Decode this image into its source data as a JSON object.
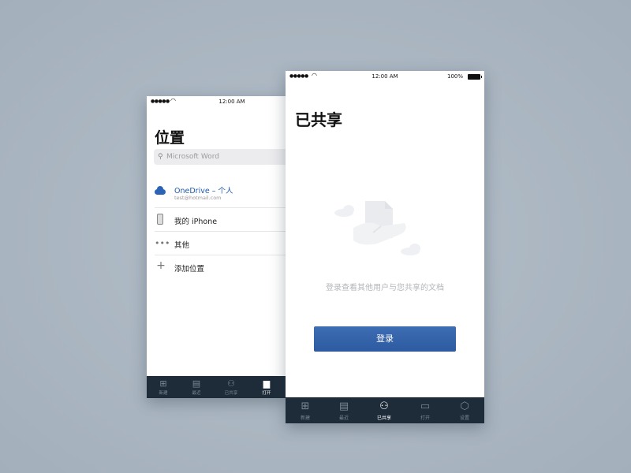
{
  "back_phone": {
    "status": {
      "time": "12:00 AM"
    },
    "title": "位置",
    "search": {
      "placeholder": "Microsoft Word"
    },
    "locations": [
      {
        "label": "OneDrive – 个人",
        "sub": "test@hotmail.com",
        "icon": "onedrive-cloud-icon"
      },
      {
        "label": "我的 iPhone",
        "icon": "iphone-icon"
      },
      {
        "label": "其他",
        "icon": "more-dots-icon"
      },
      {
        "label": "添加位置",
        "icon": "plus-icon"
      }
    ],
    "tabs": [
      {
        "label": "新建",
        "icon": "new-doc-icon",
        "active": false
      },
      {
        "label": "最近",
        "icon": "recent-icon",
        "active": false
      },
      {
        "label": "已共享",
        "icon": "shared-people-icon",
        "active": false
      },
      {
        "label": "打开",
        "icon": "folder-icon",
        "active": true
      }
    ]
  },
  "front_phone": {
    "status": {
      "time": "12:00 AM",
      "battery": "100%"
    },
    "title": "已共享",
    "message": "登录查看其他用户与您共享的文档",
    "login_button": "登录",
    "tabs": [
      {
        "label": "新建",
        "icon": "new-doc-icon",
        "active": false
      },
      {
        "label": "最近",
        "icon": "recent-icon",
        "active": false
      },
      {
        "label": "已共享",
        "icon": "shared-people-icon",
        "active": true
      },
      {
        "label": "打开",
        "icon": "folder-icon",
        "active": false
      },
      {
        "label": "设置",
        "icon": "settings-icon",
        "active": false
      }
    ]
  },
  "colors": {
    "background": "#a9b5c0",
    "tabbar": "#1e2c39",
    "accent_blue": "#2d5aa1",
    "onedrive_blue": "#1f5aad"
  }
}
